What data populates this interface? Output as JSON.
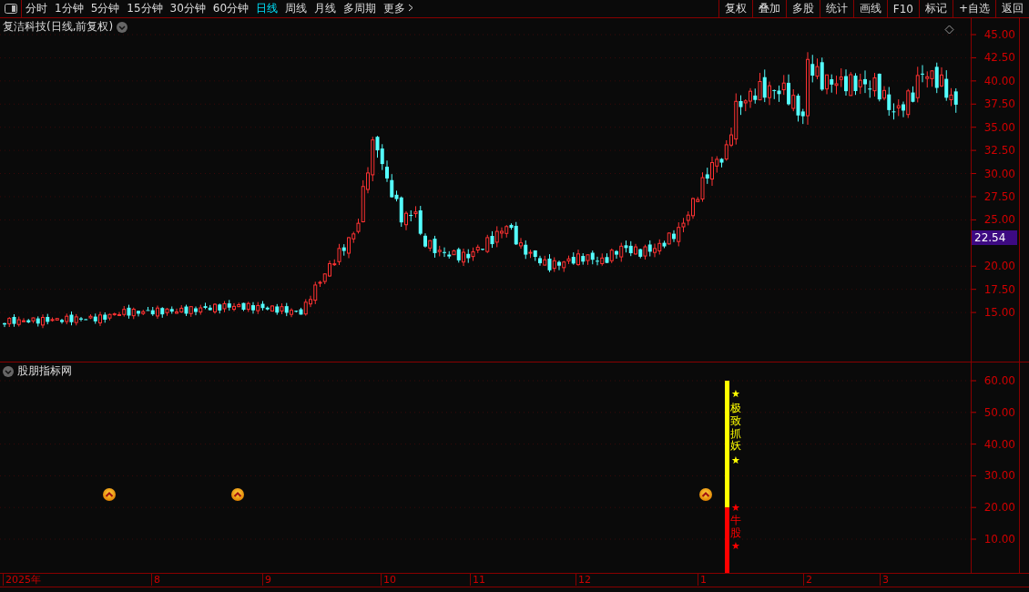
{
  "toolbar": {
    "periods": [
      {
        "label": "分时",
        "selected": false
      },
      {
        "label": "1分钟",
        "selected": false
      },
      {
        "label": "5分钟",
        "selected": false
      },
      {
        "label": "15分钟",
        "selected": false
      },
      {
        "label": "30分钟",
        "selected": false
      },
      {
        "label": "60分钟",
        "selected": false
      },
      {
        "label": "日线",
        "selected": true
      },
      {
        "label": "周线",
        "selected": false
      },
      {
        "label": "月线",
        "selected": false
      },
      {
        "label": "多周期",
        "selected": false
      }
    ],
    "more": "更多",
    "actions": [
      "复权",
      "叠加",
      "多股",
      "统计",
      "画线",
      "F10",
      "标记",
      "+自选",
      "返回"
    ]
  },
  "main_chart": {
    "title": "复洁科技(日线,前复权)",
    "y_ticks": [
      "45.00",
      "42.50",
      "40.00",
      "37.50",
      "35.00",
      "32.50",
      "30.00",
      "27.50",
      "25.00",
      "20.00",
      "17.50",
      "15.00"
    ],
    "last_price": "22.54"
  },
  "indicator": {
    "title": "股朋指标网",
    "y_ticks": [
      "60.00",
      "50.00",
      "40.00",
      "30.00",
      "20.00",
      "10.00"
    ],
    "upper_text": "极致抓妖",
    "upper_stars": [
      "★",
      "★"
    ],
    "lower_text": "牛股",
    "lower_stars": [
      "★",
      "★"
    ]
  },
  "x_axis": {
    "labels": [
      "2025年",
      "8",
      "9",
      "10",
      "11",
      "12",
      "1",
      "2",
      "3"
    ]
  }
}
